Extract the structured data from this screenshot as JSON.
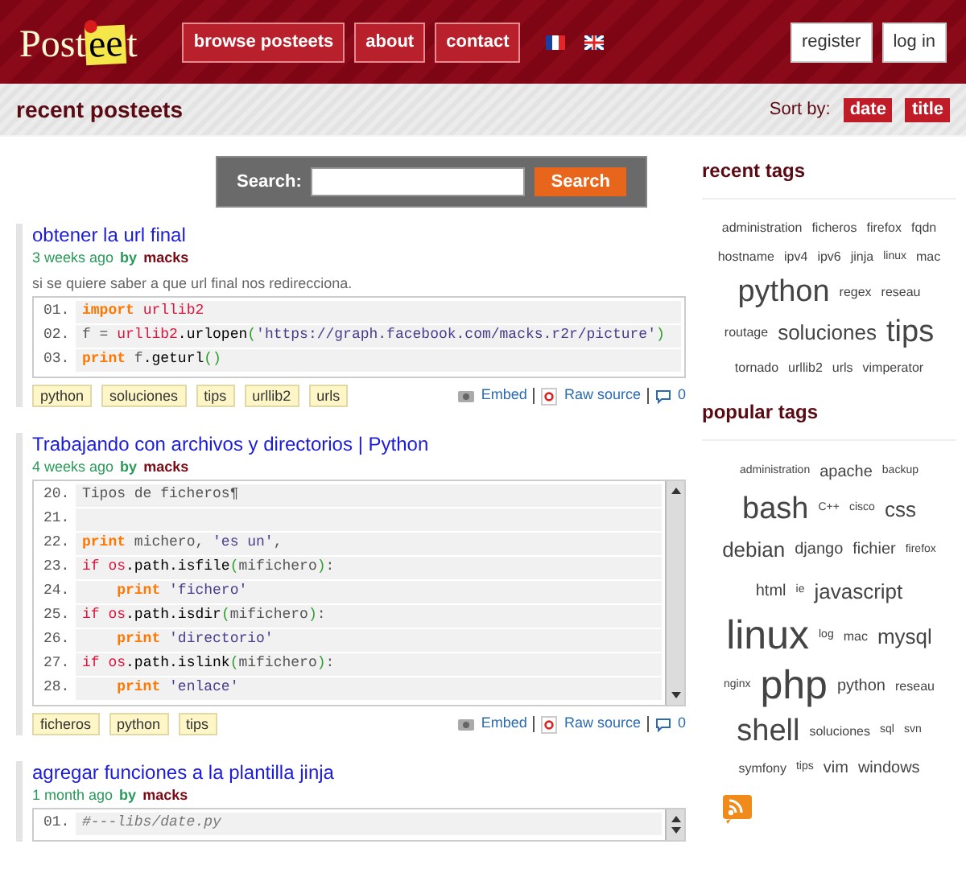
{
  "header": {
    "logo": {
      "part1": "Post",
      "part2": "ee",
      "part3": "t"
    },
    "nav": [
      "browse posteets",
      "about",
      "contact"
    ],
    "languages": [
      {
        "kind": "fr"
      },
      {
        "kind": "uk"
      }
    ],
    "account": [
      "register",
      "log in"
    ]
  },
  "subheader": {
    "title": "recent posteets",
    "sort_label": "Sort by:",
    "sort_options": [
      "date",
      "title"
    ]
  },
  "search": {
    "label": "Search:",
    "button": "Search"
  },
  "posts": [
    {
      "title": "obtener la url final",
      "age": "3 weeks ago",
      "by": "by",
      "author": "macks",
      "description": "si se quiere saber a que url final nos redirecciona.",
      "scrollable": false,
      "lines": [
        {
          "number": "01.",
          "tokens": [
            {
              "kind": "keyword",
              "text": "import "
            },
            {
              "kind": "module",
              "text": "urllib2"
            }
          ]
        },
        {
          "number": "02.",
          "tokens": [
            {
              "kind": "plain",
              "text": "f = "
            },
            {
              "kind": "module",
              "text": "urllib2"
            },
            {
              "kind": "attr",
              "text": ".urlopen"
            },
            {
              "kind": "paren",
              "text": "("
            },
            {
              "kind": "string",
              "text": "'https://graph.facebook.com/macks.r2r/picture'"
            },
            {
              "kind": "paren",
              "text": ")"
            }
          ]
        },
        {
          "number": "03.",
          "tokens": [
            {
              "kind": "keyword",
              "text": "print"
            },
            {
              "kind": "plain",
              "text": " f"
            },
            {
              "kind": "attr",
              "text": ".geturl"
            },
            {
              "kind": "paren",
              "text": "()"
            }
          ]
        }
      ],
      "tags": [
        "python",
        "soluciones",
        "tips",
        "urllib2",
        "urls"
      ],
      "actions": {
        "embed": "Embed",
        "raw": "Raw source",
        "comments": "0"
      }
    },
    {
      "title": "Trabajando con archivos y directorios | Python",
      "age": "4 weeks ago",
      "by": "by",
      "author": "macks",
      "scrollable": true,
      "lines": [
        {
          "number": "20.",
          "tokens": [
            {
              "kind": "plain",
              "text": "Tipos de ficheros¶"
            }
          ]
        },
        {
          "number": "21."
        },
        {
          "number": "22.",
          "tokens": [
            {
              "kind": "keyword",
              "text": "print"
            },
            {
              "kind": "plain",
              "text": " michero, "
            },
            {
              "kind": "string",
              "text": "'es un'"
            },
            {
              "kind": "plain",
              "text": ","
            }
          ]
        },
        {
          "number": "23.",
          "tokens": [
            {
              "kind": "module",
              "text": "if os"
            },
            {
              "kind": "attr",
              "text": ".path.isfile"
            },
            {
              "kind": "paren",
              "text": "("
            },
            {
              "kind": "plain",
              "text": "mifichero"
            },
            {
              "kind": "paren",
              "text": ")"
            },
            {
              "kind": "plain",
              "text": ":"
            }
          ]
        },
        {
          "number": "24.",
          "tokens": [
            {
              "kind": "keyword",
              "text": "    print "
            },
            {
              "kind": "string",
              "text": "'fichero'"
            }
          ]
        },
        {
          "number": "25.",
          "tokens": [
            {
              "kind": "module",
              "text": "if os"
            },
            {
              "kind": "attr",
              "text": ".path.isdir"
            },
            {
              "kind": "paren",
              "text": "("
            },
            {
              "kind": "plain",
              "text": "mifichero"
            },
            {
              "kind": "paren",
              "text": ")"
            },
            {
              "kind": "plain",
              "text": ":"
            }
          ]
        },
        {
          "number": "26.",
          "tokens": [
            {
              "kind": "keyword",
              "text": "    print "
            },
            {
              "kind": "string",
              "text": "'directorio'"
            }
          ]
        },
        {
          "number": "27.",
          "tokens": [
            {
              "kind": "module",
              "text": "if os"
            },
            {
              "kind": "attr",
              "text": ".path.islink"
            },
            {
              "kind": "paren",
              "text": "("
            },
            {
              "kind": "plain",
              "text": "mifichero"
            },
            {
              "kind": "paren",
              "text": ")"
            },
            {
              "kind": "plain",
              "text": ":"
            }
          ]
        },
        {
          "number": "28.",
          "tokens": [
            {
              "kind": "keyword",
              "text": "    print "
            },
            {
              "kind": "string",
              "text": "'enlace'"
            }
          ]
        }
      ],
      "tags": [
        "ficheros",
        "python",
        "tips"
      ],
      "actions": {
        "embed": "Embed",
        "raw": "Raw source",
        "comments": "0"
      }
    },
    {
      "title": "agregar funciones a la plantilla jinja",
      "age": "1 month ago",
      "by": "by",
      "author": "macks",
      "scrollable": true,
      "lines": [
        {
          "number": "01.",
          "tokens": [
            {
              "kind": "comment",
              "text": "#---libs/date.py"
            }
          ]
        }
      ]
    }
  ],
  "recent_tags": {
    "title": "recent tags",
    "tags": [
      {
        "text": "administration",
        "kind": "s"
      },
      {
        "text": "ficheros",
        "kind": "s"
      },
      {
        "text": "firefox",
        "kind": "s"
      },
      {
        "text": "fqdn",
        "kind": "s"
      },
      {
        "text": "hostname",
        "kind": "s"
      },
      {
        "text": "ipv4",
        "kind": "s"
      },
      {
        "text": "ipv6",
        "kind": "s"
      },
      {
        "text": "jinja",
        "kind": "s"
      },
      {
        "text": "linux",
        "kind": "xs"
      },
      {
        "text": "mac",
        "kind": "s"
      },
      {
        "text": "python",
        "kind": "xl"
      },
      {
        "text": "regex",
        "kind": "s"
      },
      {
        "text": "reseau",
        "kind": "s"
      },
      {
        "text": "routage",
        "kind": "s"
      },
      {
        "text": "soluciones",
        "kind": "l"
      },
      {
        "text": "tips",
        "kind": "xl"
      },
      {
        "text": "tornado",
        "kind": "s"
      },
      {
        "text": "urllib2",
        "kind": "s"
      },
      {
        "text": "urls",
        "kind": "s"
      },
      {
        "text": "vimperator",
        "kind": "s"
      }
    ]
  },
  "popular_tags": {
    "title": "popular tags",
    "tags": [
      {
        "text": "administration",
        "kind": "xs"
      },
      {
        "text": "apache",
        "kind": "m"
      },
      {
        "text": "backup",
        "kind": "xs"
      },
      {
        "text": "bash",
        "kind": "xl"
      },
      {
        "text": "C++",
        "kind": "xs"
      },
      {
        "text": "cisco",
        "kind": "xs"
      },
      {
        "text": "css",
        "kind": "l"
      },
      {
        "text": "debian",
        "kind": "l"
      },
      {
        "text": "django",
        "kind": "m"
      },
      {
        "text": "fichier",
        "kind": "m"
      },
      {
        "text": "firefox",
        "kind": "xs"
      },
      {
        "text": "html",
        "kind": "m"
      },
      {
        "text": "ie",
        "kind": "xs"
      },
      {
        "text": "javascript",
        "kind": "l"
      },
      {
        "text": "linux",
        "kind": "xxl"
      },
      {
        "text": "log",
        "kind": "xs"
      },
      {
        "text": "mac",
        "kind": "s"
      },
      {
        "text": "mysql",
        "kind": "l"
      },
      {
        "text": "nginx",
        "kind": "xs"
      },
      {
        "text": "php",
        "kind": "xxl"
      },
      {
        "text": "python",
        "kind": "m"
      },
      {
        "text": "reseau",
        "kind": "s"
      },
      {
        "text": "shell",
        "kind": "xl"
      },
      {
        "text": "soluciones",
        "kind": "s"
      },
      {
        "text": "sql",
        "kind": "xs"
      },
      {
        "text": "svn",
        "kind": "xs"
      },
      {
        "text": "symfony",
        "kind": "s"
      },
      {
        "text": "tips",
        "kind": "xs"
      },
      {
        "text": "vim",
        "kind": "m"
      },
      {
        "text": "windows",
        "kind": "m"
      }
    ]
  }
}
